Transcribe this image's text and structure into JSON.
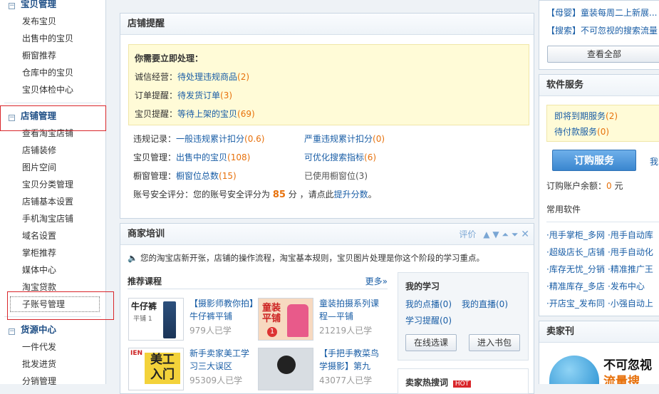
{
  "sidebar": {
    "groups": [
      {
        "label": "宝贝管理",
        "items": [
          "发布宝贝",
          "出售中的宝贝",
          "橱窗推荐",
          "仓库中的宝贝",
          "宝贝体检中心"
        ]
      },
      {
        "label": "店铺管理",
        "items": [
          "查看淘宝店铺",
          "店铺装修",
          "图片空间",
          "宝贝分类管理",
          "店铺基本设置",
          "手机淘宝店铺",
          "域名设置",
          "掌柜推荐",
          "媒体中心",
          "淘宝贷款",
          "子账号管理"
        ]
      },
      {
        "label": "货源中心",
        "items": [
          "一件代发",
          "批发进货",
          "分销管理"
        ]
      }
    ]
  },
  "reminder": {
    "title": "店铺提醒",
    "urgent_heading": "你需要立即处理：",
    "urgent": [
      {
        "label": "诚信经营：",
        "link": "待处理违规商品",
        "count": "(2)"
      },
      {
        "label": "订单提醒：",
        "link": "待发货订单",
        "count": "(3)"
      },
      {
        "label": "宝贝提醒：",
        "link": "等待上架的宝贝",
        "count": "(69)"
      }
    ],
    "rows": [
      {
        "label": "违规记录：",
        "link": "一般违规累计扣分",
        "count": "(0.6)",
        "link2": "严重违规累计扣分",
        "count2": "(0)"
      },
      {
        "label": "宝贝管理：",
        "link": "出售中的宝贝",
        "count": "(108)",
        "link2": "可优化搜索指标",
        "count2": "(6)"
      },
      {
        "label": "橱窗管理：",
        "link": "橱窗位总数",
        "count": "(15)",
        "text2": "已使用橱窗位(3)"
      }
    ],
    "security_prefix": "账号安全评分：您的账号安全评分为",
    "security_score": "85",
    "security_mid": "分 ，请点此",
    "security_link": "提升分数",
    "security_end": "。"
  },
  "training": {
    "title": "商家培训",
    "rate_label": "评价",
    "notice": "您的淘宝店新开张，店铺的操作流程，淘宝基本规则，宝贝图片处理是你这个阶段的学习重点。",
    "rec_title": "推荐课程",
    "more": "更多»",
    "courses": [
      {
        "title": "【摄影师教你拍】牛仔裤平铺",
        "learners": "979人已学",
        "thumb_text": "牛仔裤",
        "thumb_sub": "平铺 1"
      },
      {
        "title": "童装拍摄系列课程—平铺",
        "learners": "21219人已学",
        "thumb_text": "童装平铺",
        "thumb_sub": "1"
      },
      {
        "title": "新手卖家美工学习三大误区",
        "learners": "95309人已学",
        "thumb_text": "美工入门",
        "thumb_sub": "IEN"
      },
      {
        "title": "【手把手教菜鸟学摄影】第九",
        "learners": "43077人已学",
        "thumb_text": "",
        "thumb_sub": ""
      }
    ],
    "my": {
      "title": "我的学习",
      "links": [
        "我的点播(0)",
        "我的直播(0)",
        "学习提醒(0)"
      ],
      "btn1": "在线选课",
      "btn2": "进入书包"
    },
    "hot_title": "卖家热搜词",
    "hot_badge": "HOT"
  },
  "right": {
    "news": [
      {
        "tag": "【母婴】",
        "text": "童装每周二上新展..."
      },
      {
        "tag": "【搜索】",
        "text": "不可忽视的搜索流量"
      }
    ],
    "view_all": "查看全部",
    "soft_title": "软件服务",
    "soft_links": [
      {
        "text": "即将到期服务",
        "count": "(2)"
      },
      {
        "text": "待付款服务",
        "count": "(0)"
      }
    ],
    "order_btn": "订购服务",
    "order_side": "我",
    "balance_label": "订购账户余额：",
    "balance_value": "0",
    "balance_unit": "元",
    "common_title": "常用软件",
    "apps": [
      "·甩手掌柜_多网",
      "·甩手自动库",
      "·超级店长_店铺",
      "·甩手自动化",
      "·库存无忧_分销",
      "·精准推广王",
      "·精准库存_多店",
      "·发布中心",
      "·开店宝_发布同",
      "·小强自动上"
    ],
    "mag_title": "卖家刊",
    "banner_text1": "不可忽视",
    "banner_text2": "流量搜"
  },
  "colors": {
    "accent": "#1a5ea6",
    "orange": "#e7710c",
    "highlight_box": "#d9262b",
    "hot": "#d9262b"
  }
}
